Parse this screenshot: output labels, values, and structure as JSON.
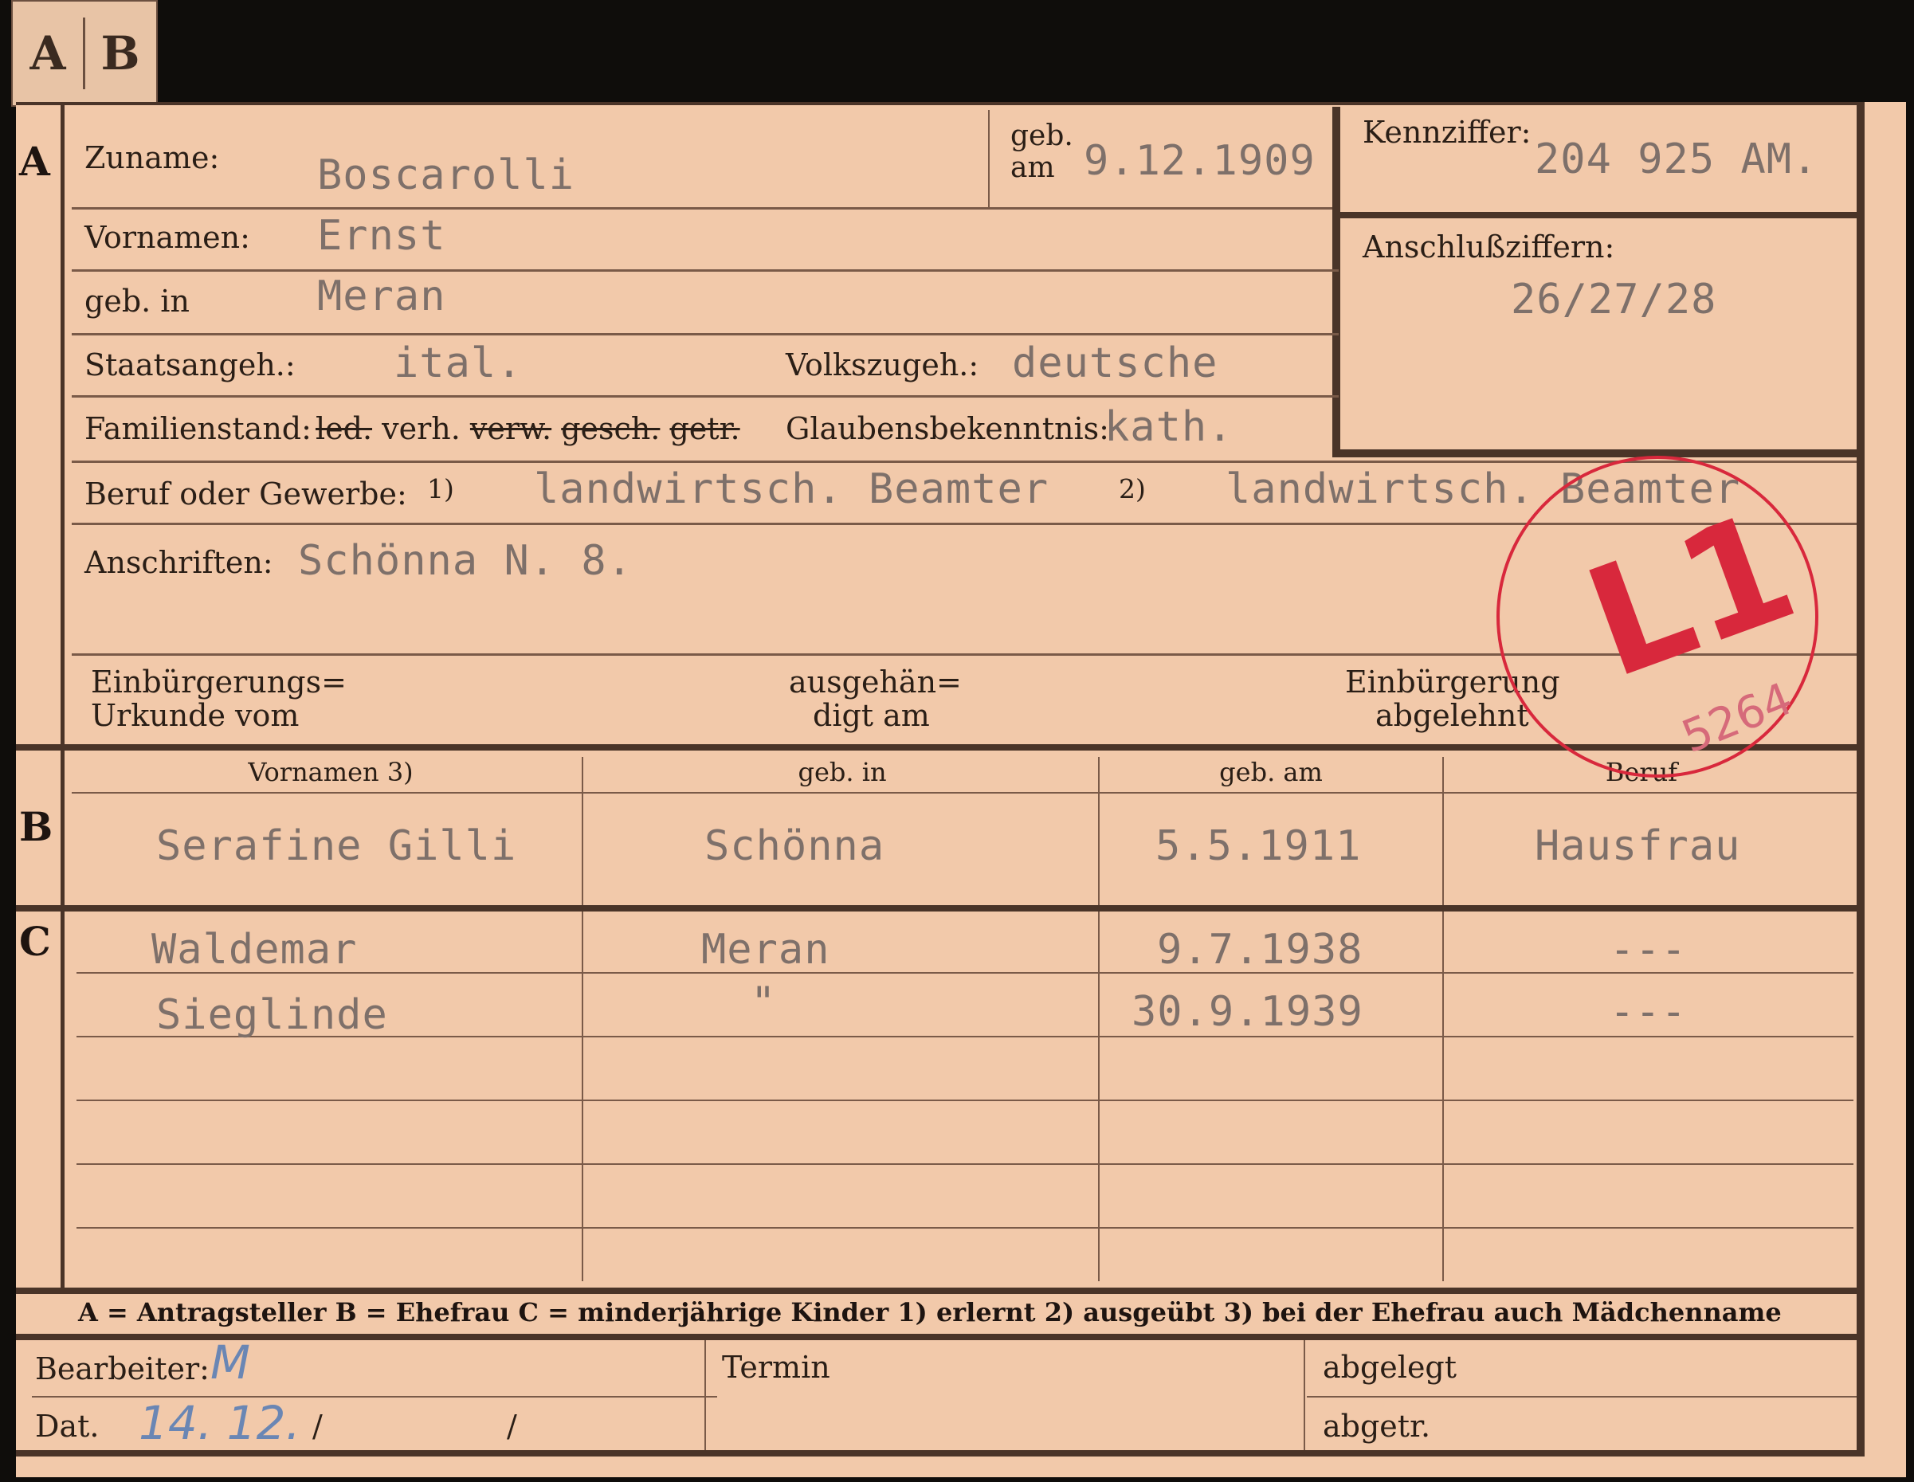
{
  "tab": {
    "a": "A",
    "b": "B"
  },
  "section_a": {
    "marker": "A",
    "zuname_label": "Zuname:",
    "zuname_value": "Boscarolli",
    "geb_am_label_1": "geb.",
    "geb_am_label_2": "am",
    "geb_am_value": "9.12.1909",
    "kennziffer_label": "Kennziffer:",
    "kennziffer_value": "204 925 AM.",
    "anschluss_label": "Anschlußziffern:",
    "anschluss_value": "26/27/28",
    "vornamen_label": "Vornamen:",
    "vornamen_value": "Ernst",
    "geb_in_label": "geb. in",
    "geb_in_value": "Meran",
    "staats_label": "Staatsangeh.:",
    "staats_value": "ital.",
    "volks_label": "Volkszugeh.:",
    "volks_value": "deutsche",
    "familienstand_label": "Familienstand:",
    "familienstand_options": [
      "led.",
      "verh.",
      "verw.",
      "gesch.",
      "getr."
    ],
    "glaubens_label": "Glaubensbekenntnis:",
    "glaubens_value": "kath.",
    "beruf_label": "Beruf oder Gewerbe:",
    "beruf_1_mark": "1)",
    "beruf_1_value": "landwirtsch. Beamter",
    "beruf_2_mark": "2)",
    "beruf_2_value": "landwirtsch. Beamter",
    "anschriften_label": "Anschriften:",
    "anschriften_value": "Schönna N. 8.",
    "einb_label_1": "Einbürgerungs=",
    "einb_label_2": "Urkunde vom",
    "ausg_label_1": "ausgehän=",
    "ausg_label_2": "digt am",
    "abgelehnt_label_1": "Einbürgerung",
    "abgelehnt_label_2": "abgelehnt"
  },
  "stamp": {
    "text": "L1",
    "note": "5264",
    "color": "#d8283c"
  },
  "section_b": {
    "marker": "B",
    "headers": [
      "Vornamen 3)",
      "geb. in",
      "geb. am",
      "Beruf"
    ],
    "row": [
      "Serafine Gilli",
      "Schönna",
      "5.5.1911",
      "Hausfrau"
    ]
  },
  "section_c": {
    "marker": "C",
    "rows": [
      [
        "Waldemar",
        "Meran",
        "9.7.1938",
        "---"
      ],
      [
        "Sieglinde",
        "\"",
        "30.9.1939",
        "---"
      ]
    ]
  },
  "legend": "A = Antragsteller   B = Ehefrau   C = minderjährige Kinder   1) erlernt   2) ausgeübt   3) bei der Ehefrau auch Mädchenname",
  "footer": {
    "bearbeiter_label": "Bearbeiter:",
    "bearbeiter_value": "M",
    "dat_label": "Dat.",
    "dat_value": "14. 12.",
    "dat_sep_1": "/",
    "dat_sep_2": "/",
    "termin_label": "Termin",
    "abgelegt_label": "abgelegt",
    "abgetr_label": "abgetr."
  }
}
